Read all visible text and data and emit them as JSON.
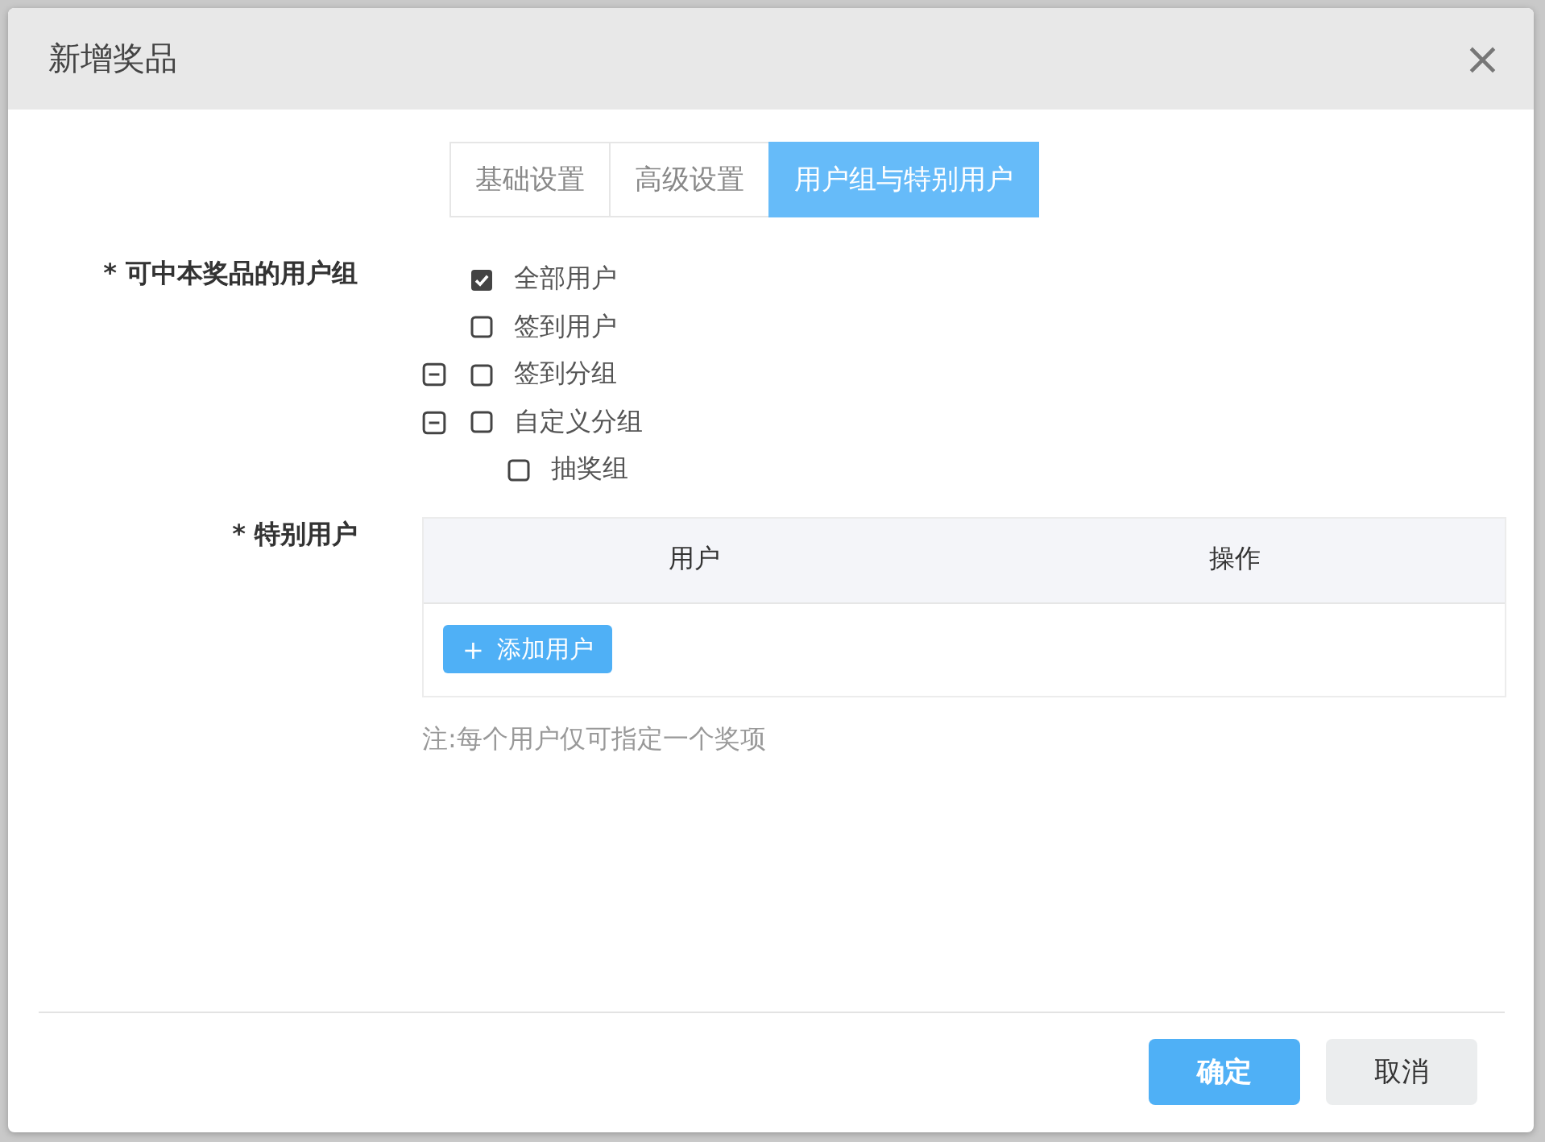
{
  "dialog": {
    "title": "新增奖品",
    "close": "×"
  },
  "tabs": [
    {
      "label": "基础设置",
      "selected": false
    },
    {
      "label": "高级设置",
      "selected": false
    },
    {
      "label": "用户组与特别用户",
      "selected": true
    }
  ],
  "user_groups": {
    "label": "* 可中本奖品的用户组",
    "tree": [
      {
        "label": "全部用户",
        "checked": true
      },
      {
        "label": "签到用户",
        "checked": false
      },
      {
        "label": "签到分组",
        "checked": false,
        "expanded": true
      },
      {
        "label": "自定义分组",
        "checked": false,
        "expanded": true,
        "children": [
          {
            "label": "抽奖组",
            "checked": false
          }
        ]
      }
    ]
  },
  "special_users": {
    "label": "* 特别用户",
    "table": {
      "columns": [
        "用户",
        "操作"
      ]
    },
    "add_button": {
      "icon": "+",
      "label": "添加用户"
    },
    "note": "注:每个用户仅可指定一个奖项"
  },
  "buttons": [
    {
      "label": "确定",
      "kind": "primary"
    },
    {
      "label": "取消",
      "kind": "secondary"
    }
  ]
}
